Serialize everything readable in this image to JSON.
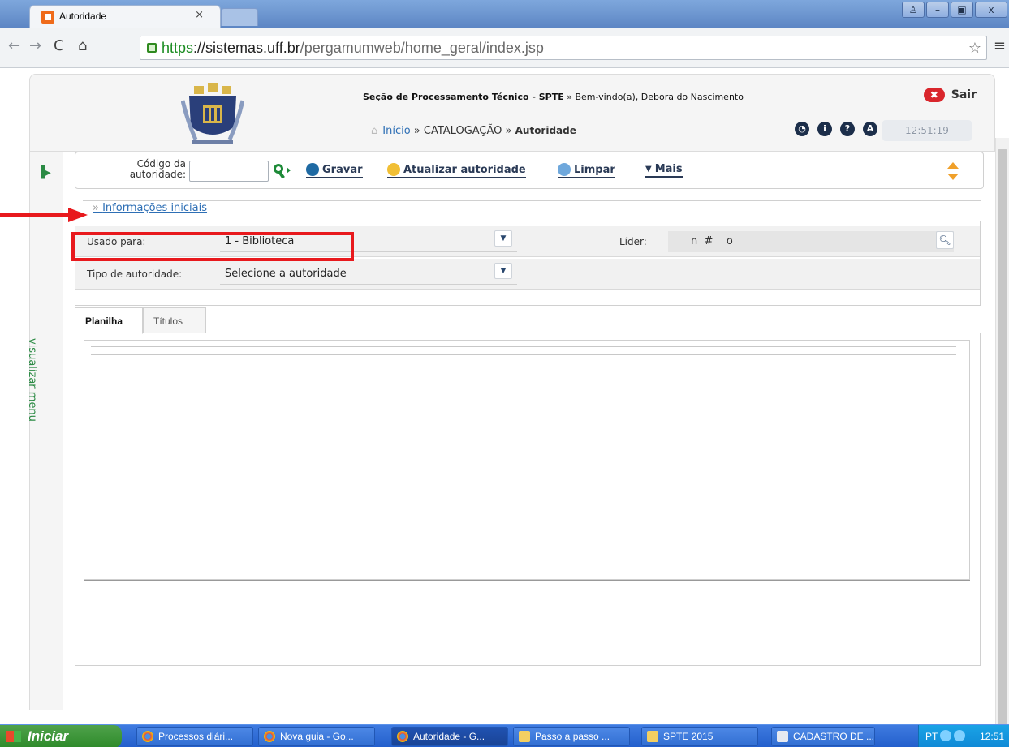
{
  "browser": {
    "tab_title": "Autoridade",
    "tab_close": "×",
    "url_secure": "https",
    "url_host": "://sistemas.uff.br",
    "url_path": "/pergamumweb/home_geral/index.jsp",
    "window_buttons": [
      "♙",
      "–",
      "▣",
      "x"
    ]
  },
  "header": {
    "section": "Seção de Processamento Técnico - SPTE",
    "welcome": " » Bem-vindo(a), Debora do Nascimento",
    "sair_label": "Sair",
    "breadcrumb_home": "Início",
    "breadcrumb_sep1": " » CATALOGAÇÃO » ",
    "breadcrumb_current": "Autoridade",
    "clock": "12:51:19"
  },
  "sidebar": {
    "menu_label": "visualizar menu"
  },
  "toolbar": {
    "codigo_label_line1": "Código da",
    "codigo_label_line2": "autoridade:",
    "gravar": "Gravar",
    "atualizar": "Atualizar autoridade",
    "limpar": "Limpar",
    "mais": "Mais"
  },
  "section": {
    "legend": "Informações iniciais",
    "legend_prefix": "» "
  },
  "form": {
    "usado_para_label": "Usado para:",
    "usado_para_value": "1 - Biblioteca",
    "tipo_label": "Tipo de autoridade:",
    "tipo_value": "Selecione a autoridade",
    "lider_label": "Líder:",
    "lider_value": "n  #    o"
  },
  "tabs": {
    "planilha": "Planilha",
    "titulos": "Títulos"
  },
  "taskbar": {
    "start": "Iniciar",
    "items": [
      "Processos diári...",
      "Nova guia - Go...",
      "Autoridade - G...",
      "Passo a passo ...",
      "SPTE 2015",
      "CADASTRO DE ..."
    ],
    "lang": "PT",
    "clock": "12:51"
  },
  "colors": {
    "annotation_red": "#e8191d",
    "link_blue": "#2e6fb5",
    "menu_green": "#2a8a43",
    "sair_red": "#d9262c"
  },
  "icons": [
    "search-icon",
    "gravar-icon",
    "refresh-icon",
    "limpar-icon",
    "chevron-down-icon",
    "lock-icon",
    "star-icon",
    "home-icon",
    "close-icon"
  ]
}
